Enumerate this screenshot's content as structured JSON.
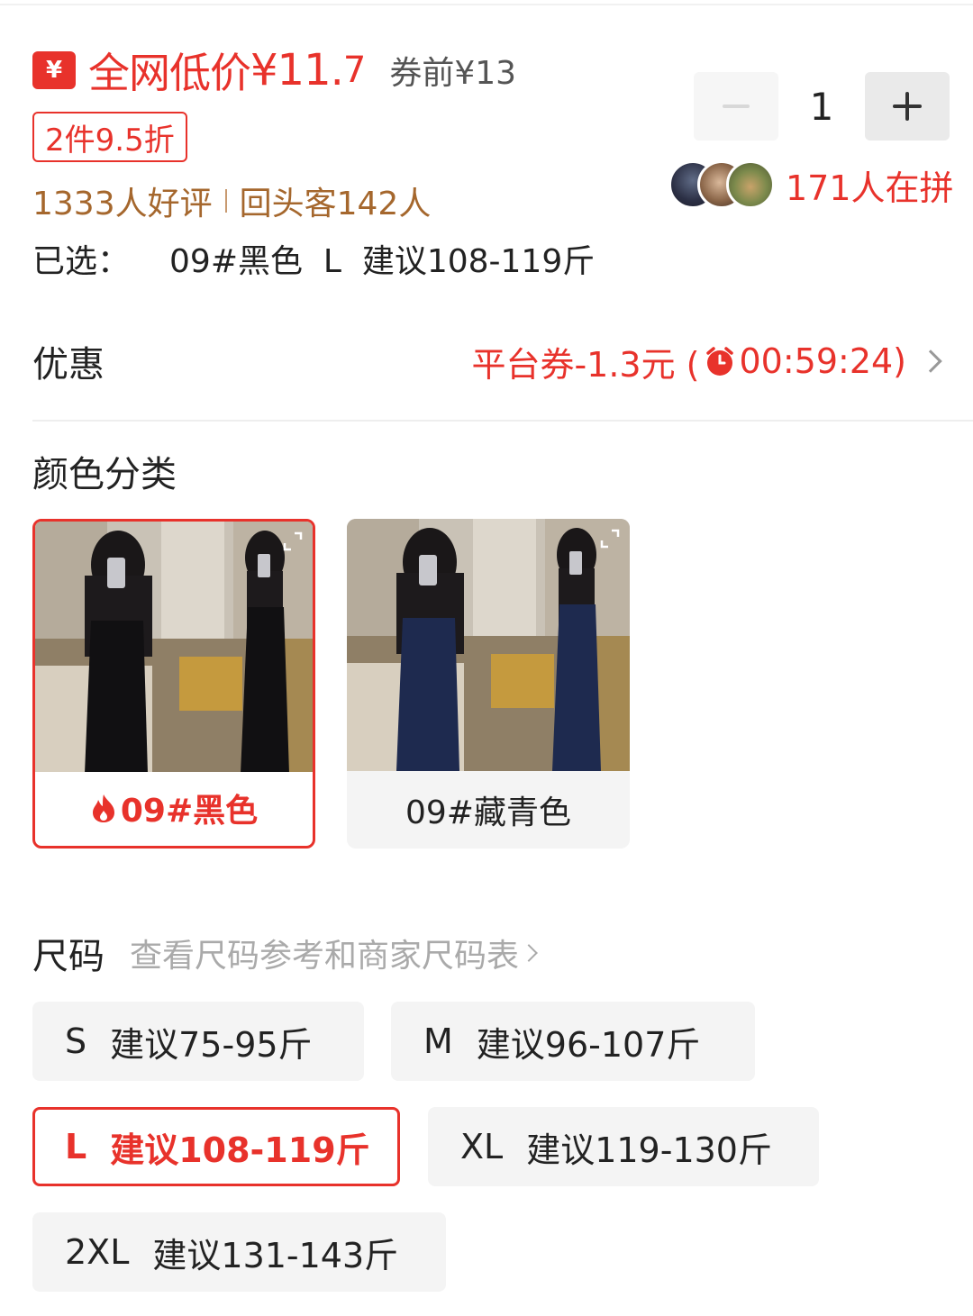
{
  "price": {
    "badge_symbol": "¥",
    "prefix": "全网低价",
    "main": "¥11.",
    "decimal": "7",
    "before_coupon": "券前¥13"
  },
  "discount_tag": "2件9.5折",
  "reviews": {
    "positive": "1333人好评",
    "repeat": "回头客142人"
  },
  "selected": {
    "label": "已选：",
    "value": "09#黑色  L  建议108-119斤"
  },
  "stepper": {
    "quantity": "1"
  },
  "group_buy": {
    "text": "171人在拼"
  },
  "coupon": {
    "title": "优惠",
    "text": "平台券-1.3元 (",
    "countdown": "00:59:24",
    "close_paren": ")"
  },
  "color_section": {
    "title": "颜色分类",
    "options": [
      {
        "label": "09#黑色",
        "selected": true,
        "hot": true
      },
      {
        "label": "09#藏青色",
        "selected": false,
        "hot": false
      }
    ]
  },
  "size_section": {
    "title": "尺码",
    "link": "查看尺码参考和商家尺码表",
    "options": [
      {
        "size": "S",
        "hint": "建议75-95斤",
        "selected": false
      },
      {
        "size": "M",
        "hint": "建议96-107斤",
        "selected": false
      },
      {
        "size": "L",
        "hint": "建议108-119斤",
        "selected": true
      },
      {
        "size": "XL",
        "hint": "建议119-130斤",
        "selected": false
      },
      {
        "size": "2XL",
        "hint": "建议131-143斤",
        "selected": false
      }
    ]
  },
  "colors": {
    "accent": "#e8322b",
    "review_brown": "#a5672d",
    "muted": "#aaaaaa"
  },
  "icons": [
    "yuan-badge-icon",
    "minus-icon",
    "plus-icon",
    "clock-icon",
    "chevron-right-icon",
    "expand-icon",
    "fire-icon"
  ]
}
